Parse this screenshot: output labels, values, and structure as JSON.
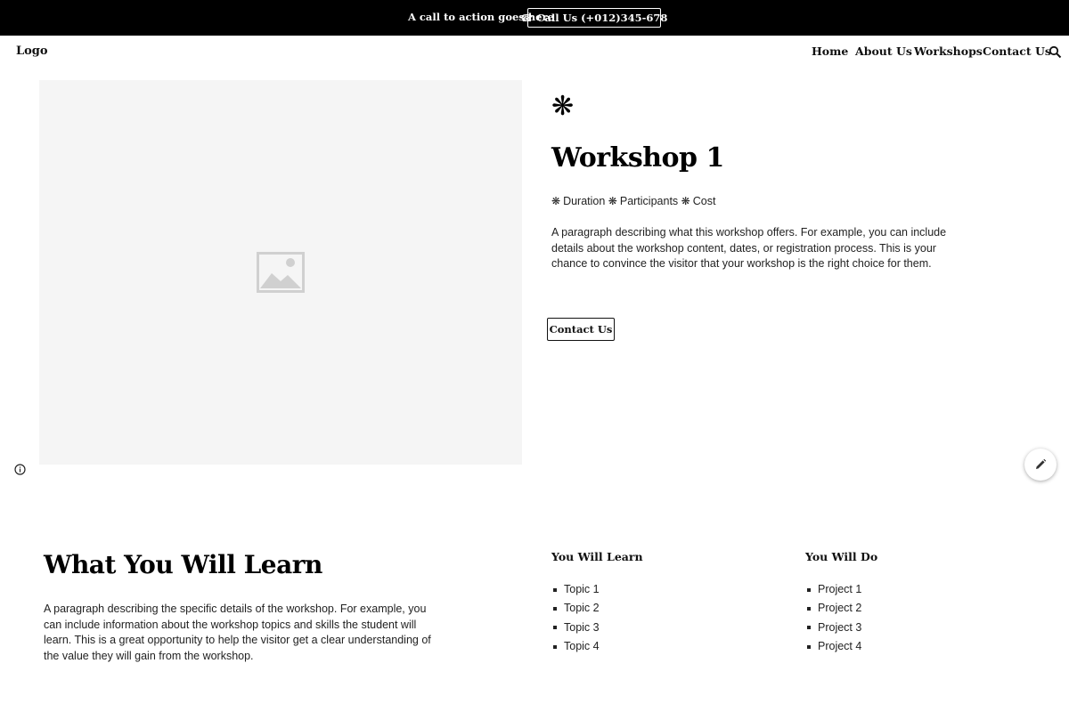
{
  "topbar": {
    "cta_text": "A call to action goes here",
    "call_button": "Call Us (+012)345-678",
    "phone_icon": "☎"
  },
  "header": {
    "logo": "Logo",
    "nav": [
      "Home",
      "About Us",
      "Workshops",
      "Contact Us"
    ],
    "search_icon": "search-icon"
  },
  "hero": {
    "image_icon": "image-placeholder-icon",
    "asterisk": "❋",
    "title": "Workshop 1",
    "meta": [
      {
        "symbol": "❋",
        "label": "Duration"
      },
      {
        "symbol": "❋",
        "label": "Participants"
      },
      {
        "symbol": "❋",
        "label": "Cost"
      }
    ],
    "description": "A paragraph describing what this workshop offers. For example, you can include details about the workshop content, dates, or registration process. This is your chance to convince the visitor that your workshop is the right choice for them.",
    "contact_button": "Contact Us"
  },
  "learn": {
    "title": "What You Will Learn",
    "description": "A paragraph describing the specific details of the workshop. For example, you can include information about the workshop topics and skills the student will learn. This is a great opportunity to help the visitor get a clear understanding of the value they will gain from the workshop.",
    "learn_col": {
      "heading": "You Will Learn",
      "items": [
        "Topic 1",
        "Topic 2",
        "Topic 3",
        "Topic 4"
      ]
    },
    "do_col": {
      "heading": "You Will Do",
      "items": [
        "Project 1",
        "Project 2",
        "Project 3",
        "Project 4"
      ]
    }
  },
  "colors": {
    "topbar_bg": "#000000",
    "placeholder_bg": "#f5f5f5",
    "placeholder_icon": "#d0d0d0",
    "text": "#111111"
  }
}
